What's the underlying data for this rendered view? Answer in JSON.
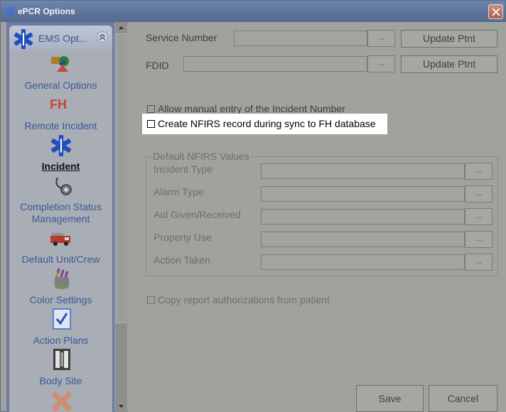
{
  "window": {
    "title": "ePCR Options",
    "close_icon": "close-icon"
  },
  "sidebar": {
    "header_label": "EMS Opt...",
    "items": [
      {
        "label": "General Options",
        "icon": "general-options-icon"
      },
      {
        "label": "Remote Incident",
        "icon": "fh-icon"
      },
      {
        "label": "Incident",
        "icon": "star-of-life-icon",
        "active": true
      },
      {
        "label": "Completion Status Management",
        "line1": "Completion Status",
        "line2": "Management",
        "icon": "stethoscope-icon"
      },
      {
        "label": "Default Unit/Crew",
        "icon": "fire-truck-icon"
      },
      {
        "label": "Color Settings",
        "icon": "paint-can-icon"
      },
      {
        "label": "Action Plans",
        "icon": "checklist-icon"
      },
      {
        "label": "Body Site",
        "icon": "body-site-icon"
      }
    ]
  },
  "form": {
    "service_number_label": "Service Number",
    "service_number_value": "",
    "fdid_label": "FDID",
    "fdid_value": "",
    "dots": "...",
    "update_ptnt": "Update Ptnt",
    "allow_manual_label": "Allow manual entry of the Incident Number",
    "create_nfirs_label": "Create NFIRS record during sync to FH database",
    "nfirs_group_title": "Default NFIRS Values",
    "nfirs_fields": [
      {
        "label": "Incident Type",
        "value": ""
      },
      {
        "label": "Alarm Type",
        "value": ""
      },
      {
        "label": "Aid Given/Received",
        "value": ""
      },
      {
        "label": "Property Use",
        "value": ""
      },
      {
        "label": "Action Taken",
        "value": ""
      }
    ],
    "copy_auth_label": "Copy report authorizations from patient"
  },
  "buttons": {
    "save": "Save",
    "cancel": "Cancel"
  },
  "colors": {
    "accent": "#3a5a92",
    "sidebar_bg": "#6c7ba2",
    "highlight": "#ffffff"
  }
}
